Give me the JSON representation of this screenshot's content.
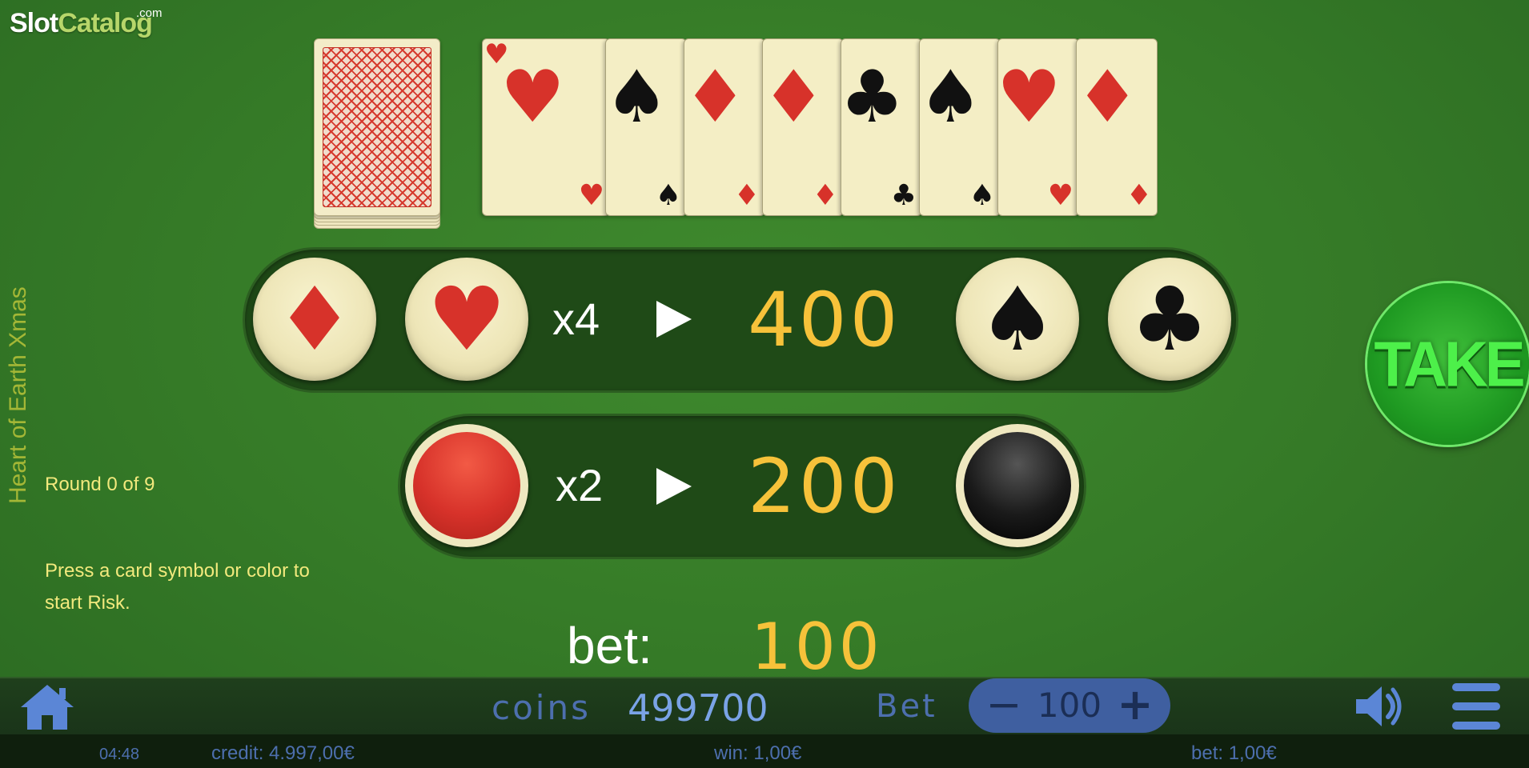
{
  "logo": {
    "main_left": "Slot",
    "main_right": "Catalog",
    "suffix": ".com"
  },
  "game": {
    "title": "Heart of Earth Xmas",
    "round_text": "Round 0 of 9",
    "hint_text": "Press a card symbol or color to start Risk."
  },
  "history_cards": [
    {
      "suit": "hearts",
      "glyph": "♥",
      "color": "red"
    },
    {
      "suit": "spades",
      "glyph": "♠",
      "color": "black"
    },
    {
      "suit": "diamonds",
      "glyph": "♦",
      "color": "red"
    },
    {
      "suit": "diamonds",
      "glyph": "♦",
      "color": "red"
    },
    {
      "suit": "clubs",
      "glyph": "♣",
      "color": "black"
    },
    {
      "suit": "spades",
      "glyph": "♠",
      "color": "black"
    },
    {
      "suit": "hearts",
      "glyph": "♥",
      "color": "red"
    },
    {
      "suit": "diamonds",
      "glyph": "♦",
      "color": "red"
    }
  ],
  "suit_row": {
    "multiplier": "x4",
    "win": "400",
    "buttons": {
      "diamond": "♦",
      "heart": "♥",
      "spade": "♠",
      "club": "♣"
    }
  },
  "color_row": {
    "multiplier": "x2",
    "win": "200"
  },
  "bet": {
    "label": "bet:",
    "value": "100"
  },
  "take_label": "TAKE",
  "bottom_bar": {
    "coins_label": "coins",
    "coins_value": "499700",
    "bet_label": "Bet",
    "bet_value": "100",
    "minus": "−",
    "plus": "+"
  },
  "status": {
    "time": "04:48",
    "credit": "credit: 4.997,00€",
    "win": "win: 1,00€",
    "bet": "bet: 1,00€"
  },
  "colors": {
    "felt": "#357a27",
    "gold": "#f6c23a",
    "card_red": "#d7322a",
    "take_green": "#4df04a",
    "ui_blue": "#4d6fae"
  },
  "icons": [
    "home-icon",
    "sound-icon",
    "menu-icon"
  ]
}
